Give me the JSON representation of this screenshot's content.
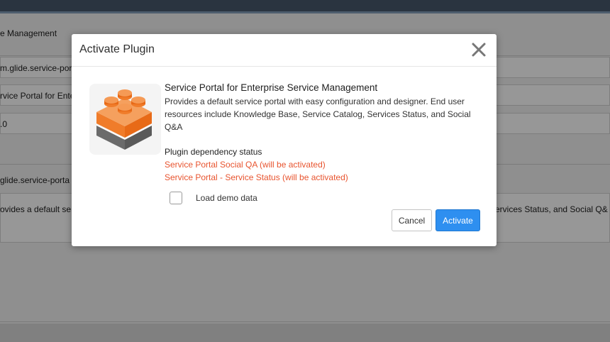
{
  "background": {
    "rows": [
      {
        "text": "e Management"
      },
      {
        "text": "m.glide.service-por"
      },
      {
        "text": "rvice Portal for Ente"
      },
      {
        "text": ".0"
      },
      {
        "text": "glide.service-porta"
      },
      {
        "text": "ovides a default ser"
      },
      {
        "text": "ervices Status, and Social Q&"
      }
    ]
  },
  "modal": {
    "title": "Activate Plugin",
    "close_icon": "close-icon",
    "plugin": {
      "icon": "plugin-blocks-icon",
      "title": "Service Portal for Enterprise Service Management",
      "description": "Provides a default service portal with easy configuration and designer. End user resources include Knowledge Base, Service Catalog, Services Status, and Social Q&A"
    },
    "dependency": {
      "label": "Plugin dependency status",
      "items": [
        "Service Portal Social QA (will be activated)",
        "Service Portal - Service Status (will be activated)"
      ],
      "color": "#e8542f"
    },
    "demo_data": {
      "label": "Load demo data",
      "checked": false
    },
    "buttons": {
      "cancel": "Cancel",
      "activate": "Activate"
    },
    "colors": {
      "accent": "#2e8ff0",
      "icon_orange": "#f07c2a",
      "icon_gray": "#6b6b6b"
    }
  }
}
